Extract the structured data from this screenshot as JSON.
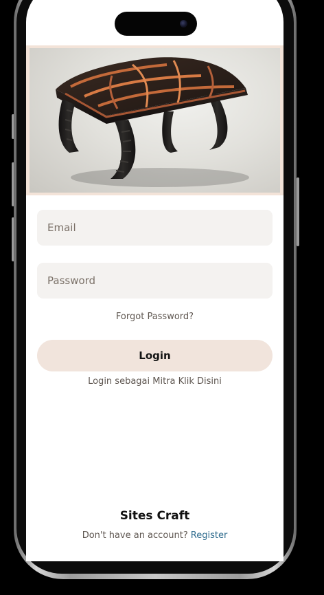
{
  "hero": {
    "image_alt": "Ottoman stool made from recycled tires"
  },
  "form": {
    "email_placeholder": "Email",
    "password_placeholder": "Password",
    "forgot_password": "Forgot Password?",
    "login_button": "Login",
    "partner_login": "Login sebagai Mitra Klik Disini"
  },
  "footer": {
    "brand": "Sites Craft",
    "no_account": "Don't have an account?",
    "register": "Register"
  },
  "colors": {
    "background": "#000000",
    "screen": "#ffffff",
    "accent_beige": "#f1e4dc",
    "input_bg": "#f4f2f0",
    "link_blue": "#2f6c8e",
    "text_muted": "#5e5650"
  }
}
